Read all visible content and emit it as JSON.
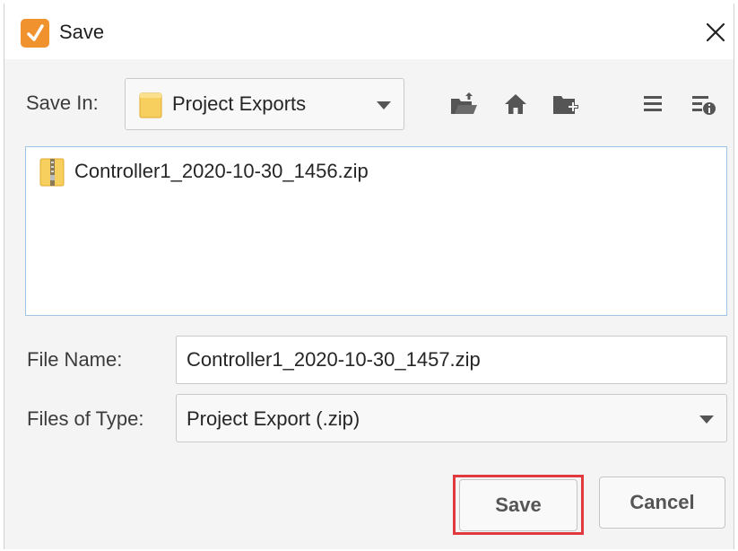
{
  "dialog": {
    "title": "Save",
    "icon": "ignition-designer-icon",
    "close_icon": "close-icon"
  },
  "save_in": {
    "label": "Save In:",
    "selected": "Project Exports",
    "folder_icon": "folder-icon"
  },
  "toolbar": {
    "icons": [
      "up-folder-icon",
      "home-icon",
      "new-folder-icon",
      "list-view-icon",
      "details-view-icon"
    ]
  },
  "files": [
    {
      "name": "Controller1_2020-10-30_1456.zip",
      "icon": "zip-file-icon"
    }
  ],
  "file_name": {
    "label": "File Name:",
    "value": "Controller1_2020-10-30_1457.zip"
  },
  "file_type": {
    "label": "Files of Type:",
    "selected": "Project Export (.zip)"
  },
  "buttons": {
    "save": "Save",
    "cancel": "Cancel"
  },
  "colors": {
    "highlight": "#e0393e",
    "app_icon": "#f0922d",
    "list_border": "#9fc4e4"
  }
}
